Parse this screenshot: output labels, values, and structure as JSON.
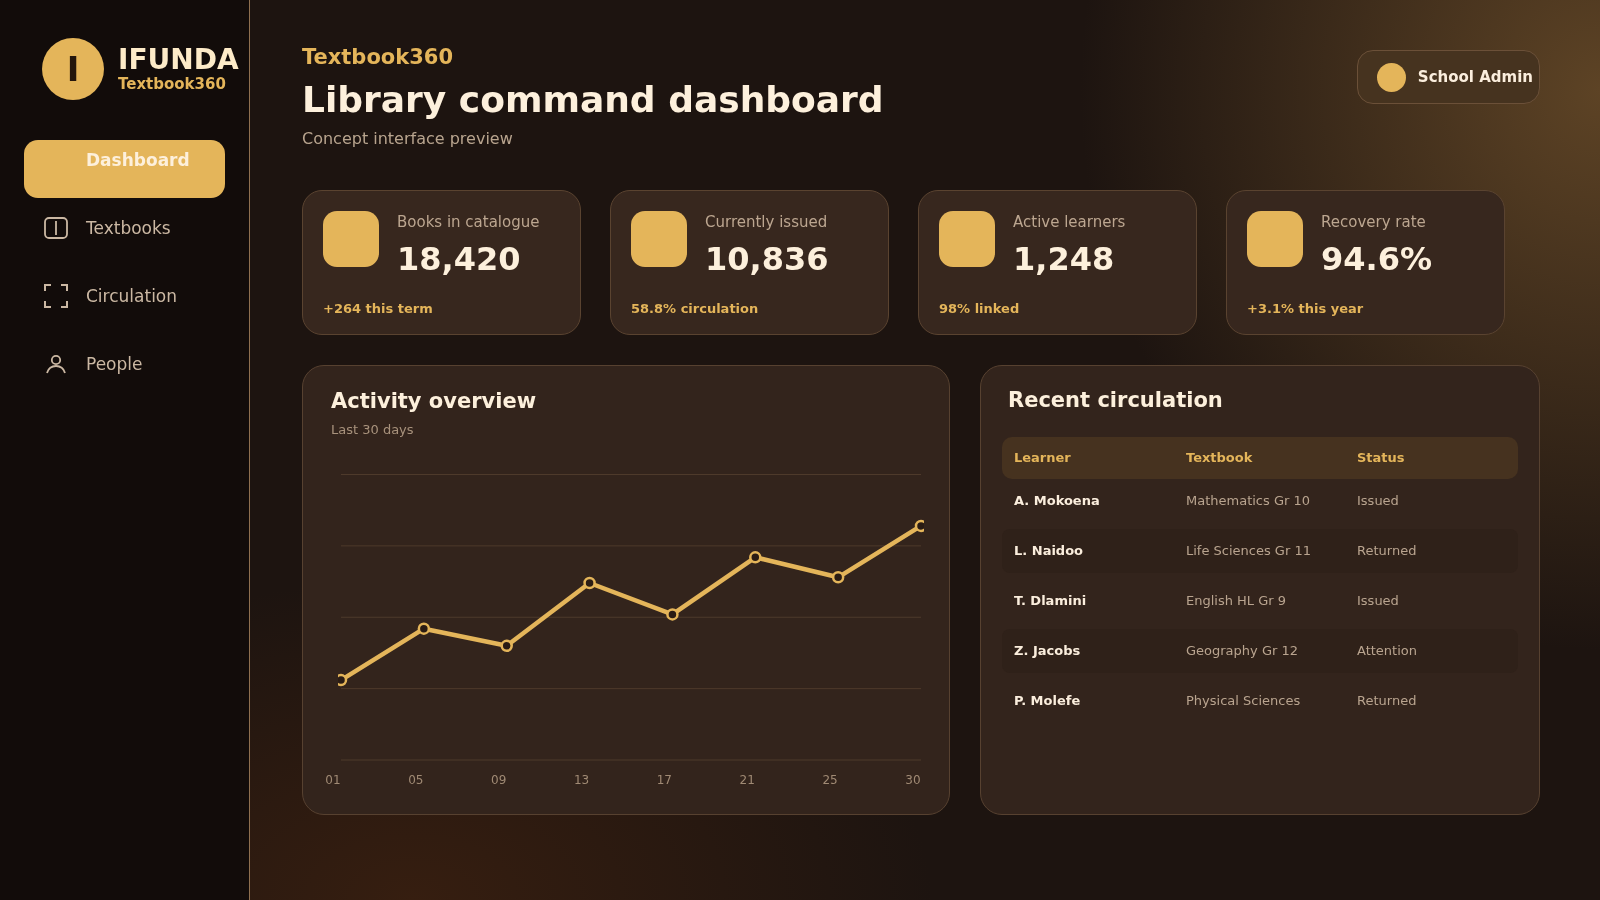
{
  "brand": {
    "mark": "I",
    "name": "IFUNDA",
    "tagline": "Textbook360"
  },
  "sidebar": {
    "items": [
      {
        "label": "Dashboard",
        "selected": true
      },
      {
        "label": "Textbooks",
        "selected": false
      },
      {
        "label": "Circulation",
        "selected": false
      },
      {
        "label": "People",
        "selected": false
      }
    ]
  },
  "header": {
    "eyebrow": "Textbook360",
    "title": "Library command dashboard",
    "subtitle": "Concept interface preview"
  },
  "user": {
    "name": "School Admin"
  },
  "stats": [
    {
      "label": "Books in catalogue",
      "value": "18,420",
      "note": "+264 this term"
    },
    {
      "label": "Currently issued",
      "value": "10,836",
      "note": "58.8% circulation"
    },
    {
      "label": "Active learners",
      "value": "1,248",
      "note": "98% linked"
    },
    {
      "label": "Recovery rate",
      "value": "94.6%",
      "note": "+3.1% this year"
    }
  ],
  "activity": {
    "title": "Activity overview",
    "subtitle": "Last 30 days",
    "axis_labels": [
      "01",
      "05",
      "09",
      "13",
      "17",
      "21",
      "25",
      "30"
    ]
  },
  "circulation": {
    "title": "Recent circulation",
    "columns": [
      "Learner",
      "Textbook",
      "Status"
    ],
    "rows": [
      [
        "A. Mokoena",
        "Mathematics Gr 10",
        "Issued"
      ],
      [
        "L. Naidoo",
        "Life Sciences Gr 11",
        "Returned"
      ],
      [
        "T. Dlamini",
        "English HL Gr 9",
        "Issued"
      ],
      [
        "Z. Jacobs",
        "Geography Gr 12",
        "Attention"
      ],
      [
        "P. Molefe",
        "Physical Sciences",
        "Returned"
      ]
    ]
  }
}
